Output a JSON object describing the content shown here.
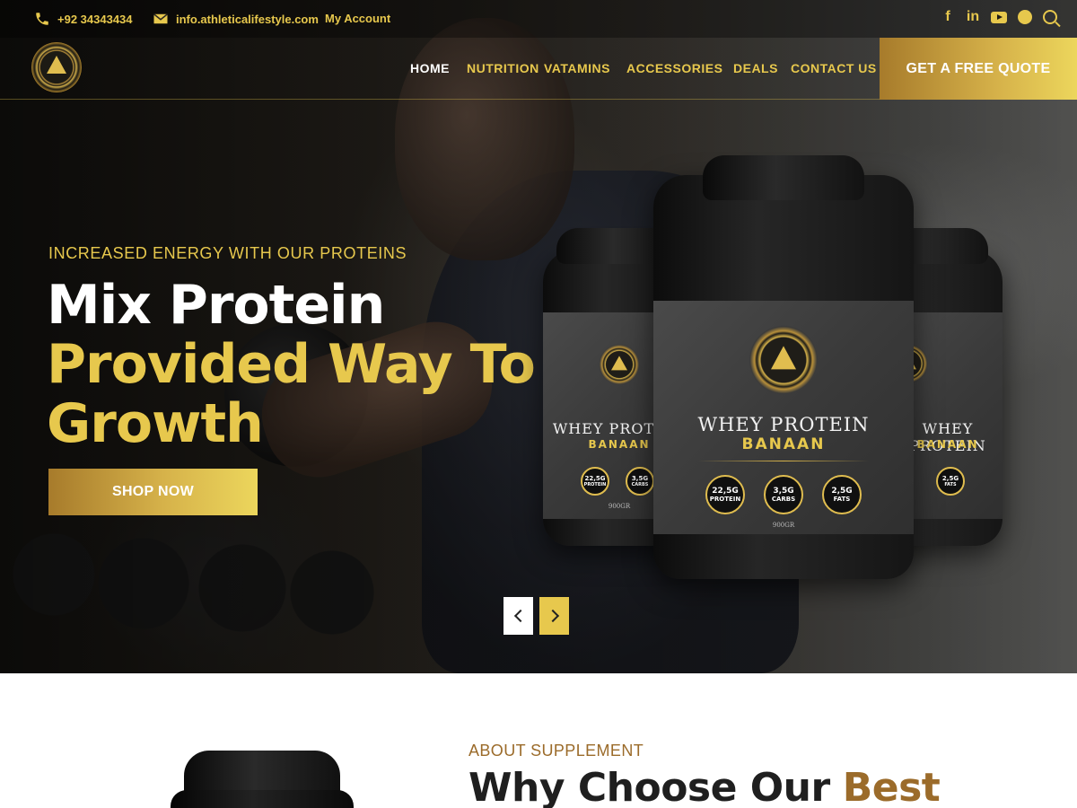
{
  "colors": {
    "gold": "#e7c84d",
    "gold_dark": "#a77b2b",
    "accent_brown": "#9b6b2a",
    "white": "#ffffff",
    "dark": "#1f1f1f"
  },
  "topbar": {
    "phone": "+92 34343434",
    "email": "info.athleticalifestyle.com",
    "account_label": "My Account",
    "social_icons": [
      "facebook-icon",
      "linkedin-icon",
      "youtube-icon",
      "skype-icon",
      "search-icon"
    ]
  },
  "nav": {
    "items": [
      {
        "label": "HOME",
        "active": true
      },
      {
        "label": "NUTRITION",
        "active": false
      },
      {
        "label": "VATAMINS",
        "active": false
      },
      {
        "label": "ACCESSORIES",
        "active": false
      },
      {
        "label": "DEALS",
        "active": false
      },
      {
        "label": "CONTACT US",
        "active": false
      }
    ],
    "cta_label": "GET A FREE QUOTE"
  },
  "hero": {
    "tagline": "INCREASED ENERGY WITH OUR PROTEINS",
    "headline_white": "Mix Protein",
    "headline_gold_1": "Provided Way To",
    "headline_gold_2": "Growth",
    "cta_label": "SHOP NOW",
    "product": {
      "title": "WHEY PROTEIN",
      "flavor": "BANAAN",
      "weight": "900GR",
      "nutrients": [
        {
          "value": "22,5G",
          "label": "PROTEIN"
        },
        {
          "value": "3,5G",
          "label": "CARBS"
        },
        {
          "value": "2,5G",
          "label": "FATS"
        }
      ]
    }
  },
  "about": {
    "kicker": "ABOUT SUPPLEMENT",
    "title": "Why Choose Our",
    "title_accent": "Best"
  }
}
